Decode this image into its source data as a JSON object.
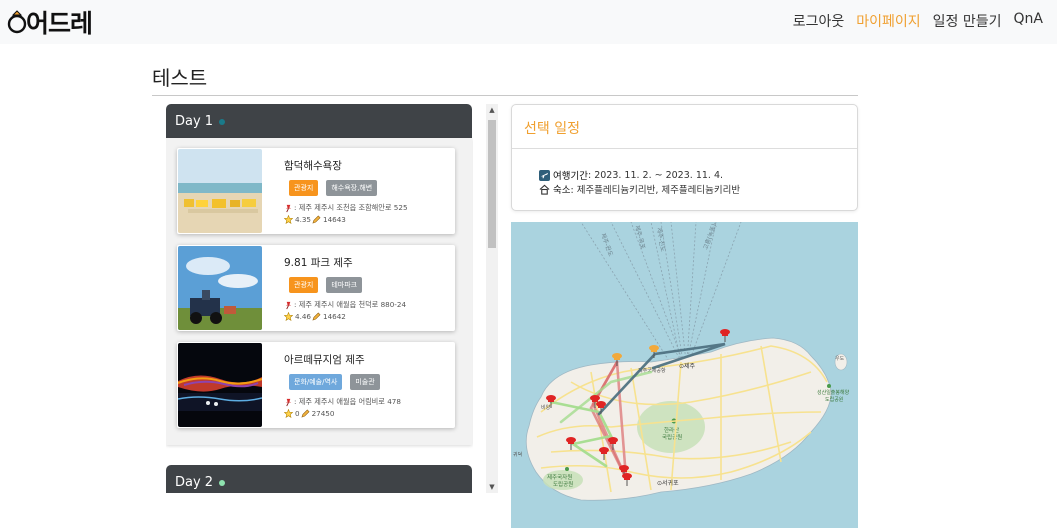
{
  "navbar": {
    "logo": "어드레",
    "links": [
      "로그아웃",
      "마이페이지",
      "일정 만들기",
      "QnA"
    ]
  },
  "page": {
    "title": "테스트"
  },
  "days": [
    {
      "label": "Day 1",
      "places": [
        {
          "title": "함덕해수욕장",
          "badges": [
            "관광지",
            "해수욕장,해변"
          ],
          "address": " : 제주 제주시 조천읍 조함해안로 525",
          "rating": "4.35",
          "count": "14643"
        },
        {
          "title": "9.81 파크 제주",
          "badges": [
            "관광지",
            "테마파크"
          ],
          "address": " : 제주 제주시 애월읍 천덕로 880-24",
          "rating": "4.46",
          "count": "14642"
        },
        {
          "title": "아르떼뮤지엄 제주",
          "badges": [
            "문화/예술/역사",
            "미술관"
          ],
          "address": " : 제주 제주시 애월읍 어림비로 478",
          "rating": "0",
          "count": "27450"
        }
      ]
    },
    {
      "label": "Day 2"
    }
  ],
  "selected": {
    "title": "선택 일정",
    "period_label": "여행기간",
    "period_value": " : 2023. 11. 2. ~ 2023. 11. 4.",
    "stay_label": "숙소",
    "stay_value": " : 제주플레티늄키리반, 제주플레티늄키리반"
  },
  "map": {
    "labels": {
      "jeju": "⊙제주",
      "airport": "제주국제공항",
      "seogwipo": "⊙서귀포",
      "hallasan": "한라산\n국립공원",
      "hallasan_a": "한라산",
      "hallasan_b": "국립공원",
      "forest_a": "제주국자원",
      "forest_b": "도립공원",
      "seongsan_a": "성산일출봉해양",
      "seongsan_b": "도립공원",
      "udo": "우도",
      "ferry1": "제주-완도",
      "ferry2": "제주-목포",
      "ferry3": "제주-진도",
      "ferry4": "고흥(녹동)-제주",
      "gwideok": "귀덕",
      "biyang": "비양"
    }
  },
  "colors": {
    "accent": "#f0a030",
    "day_header": "#3f4347",
    "day1_dot": "#1a7a8a",
    "day2_dot": "#8fe3b0",
    "sea": "#aad3df",
    "land": "#f2efe9"
  }
}
